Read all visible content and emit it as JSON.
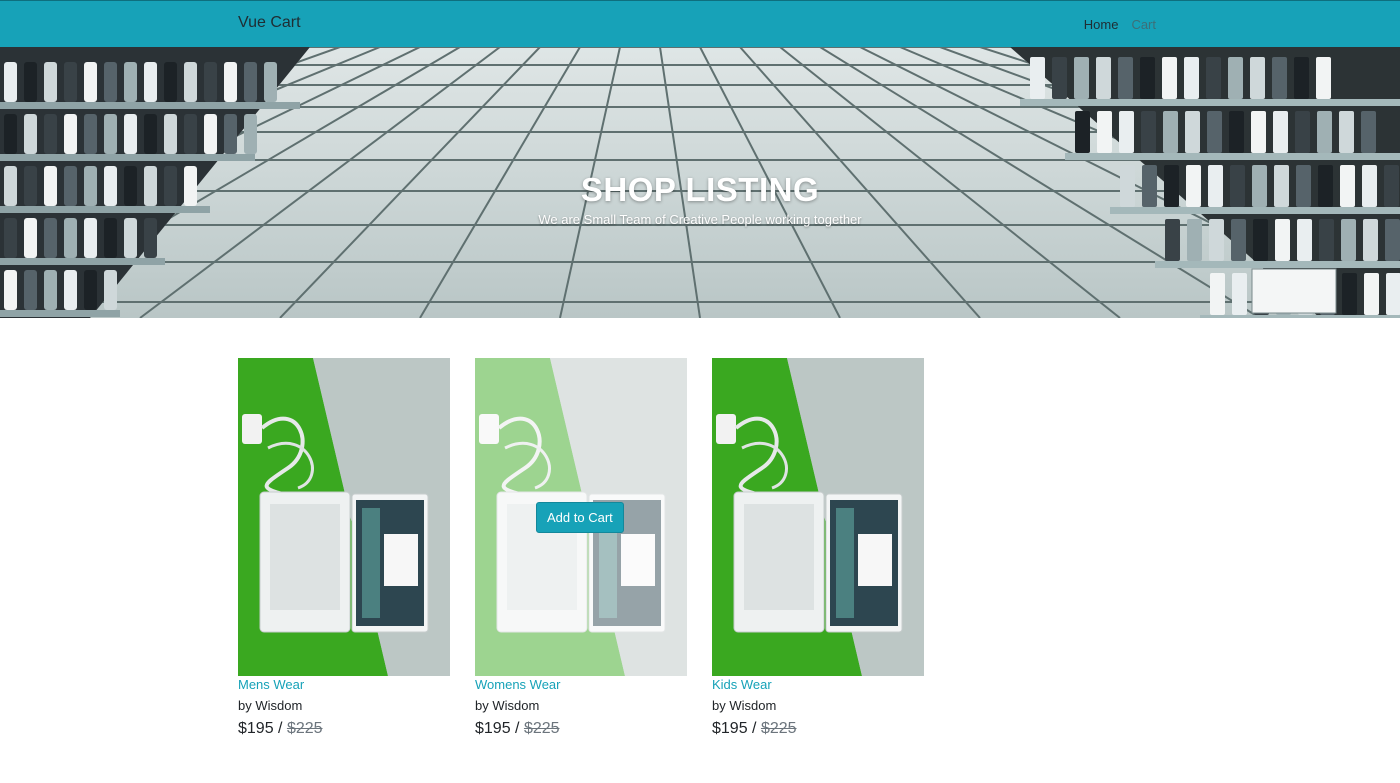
{
  "navbar": {
    "brand": "Vue Cart",
    "links": [
      {
        "label": "Home",
        "active": true
      },
      {
        "label": "Cart",
        "active": false
      }
    ]
  },
  "hero": {
    "title": "SHOP LISTING",
    "subtitle": "We are Small Team of Creative People working together"
  },
  "products": [
    {
      "title": "Mens Wear",
      "author": "by Wisdom",
      "price": "$195",
      "separator": " / ",
      "old_price": "$225",
      "hovered": false
    },
    {
      "title": "Womens Wear",
      "author": "by Wisdom",
      "price": "$195",
      "separator": " / ",
      "old_price": "$225",
      "hovered": true,
      "button": "Add to Cart"
    },
    {
      "title": "Kids Wear",
      "author": "by Wisdom",
      "price": "$195",
      "separator": " / ",
      "old_price": "$225",
      "hovered": false
    }
  ],
  "colors": {
    "navbar": "#17a2b8",
    "link": "#17a2b8",
    "button": "#17a2b8",
    "product_green": "#3aa820"
  }
}
